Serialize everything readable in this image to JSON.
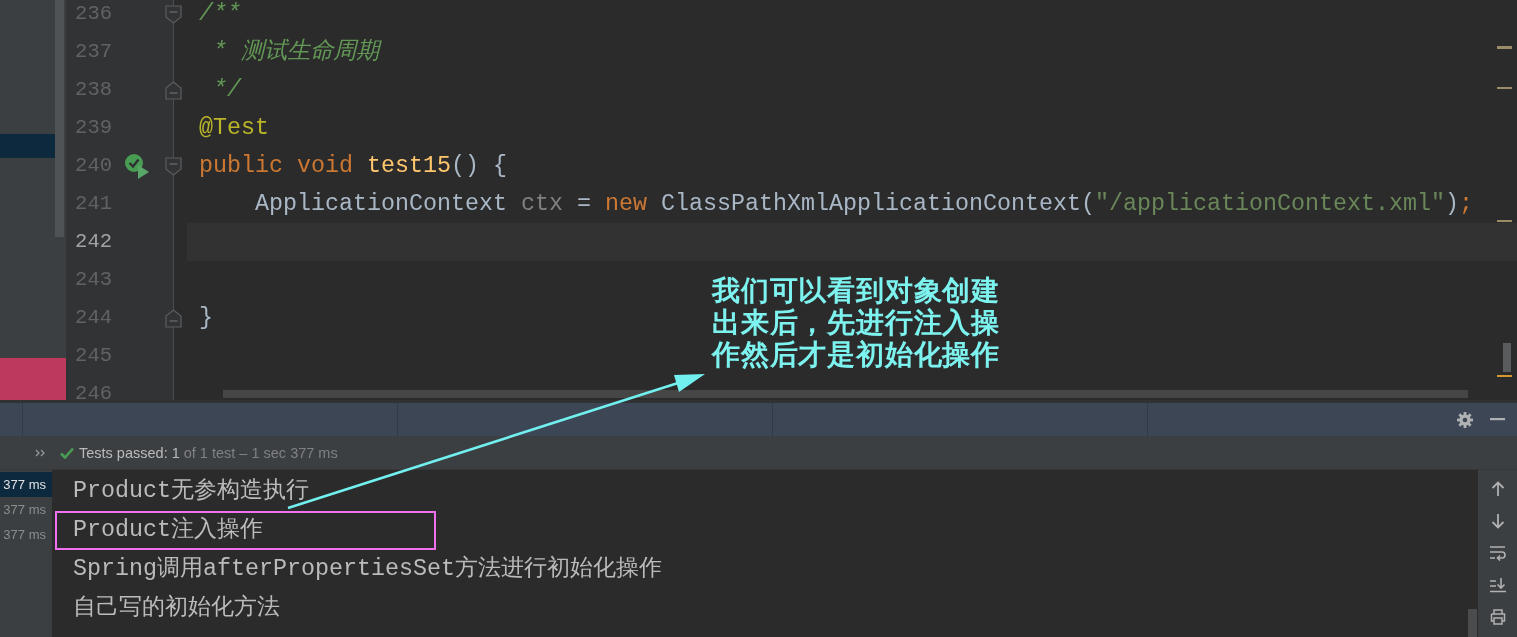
{
  "editor": {
    "lines": [
      {
        "number": "236",
        "current": false,
        "run_marker": false,
        "fold_start": true,
        "fold_end": false,
        "tokens": [
          {
            "kind": "comment",
            "text": "/**"
          }
        ]
      },
      {
        "number": "237",
        "current": false,
        "run_marker": false,
        "fold_start": false,
        "fold_end": false,
        "tokens": [
          {
            "kind": "comment",
            "text": " * 测试生命周期"
          }
        ]
      },
      {
        "number": "238",
        "current": false,
        "run_marker": false,
        "fold_start": false,
        "fold_end": true,
        "tokens": [
          {
            "kind": "comment",
            "text": " */"
          }
        ]
      },
      {
        "number": "239",
        "current": false,
        "run_marker": false,
        "fold_start": false,
        "fold_end": false,
        "tokens": [
          {
            "kind": "annotation",
            "text": "@Test"
          }
        ]
      },
      {
        "number": "240",
        "current": false,
        "run_marker": true,
        "fold_start": true,
        "fold_end": false,
        "tokens": [
          {
            "kind": "keyword",
            "text": "public void "
          },
          {
            "kind": "method",
            "text": "test15"
          },
          {
            "kind": "plain",
            "text": "() {"
          }
        ]
      },
      {
        "number": "241",
        "current": false,
        "run_marker": false,
        "fold_start": false,
        "fold_end": false,
        "tokens": [
          {
            "kind": "plain",
            "text": "    ApplicationContext "
          },
          {
            "kind": "unused",
            "text": "ctx"
          },
          {
            "kind": "plain",
            "text": " = "
          },
          {
            "kind": "keyword",
            "text": "new"
          },
          {
            "kind": "plain",
            "text": " ClassPathXmlApplicationContext("
          },
          {
            "kind": "string",
            "text": "\"/applicationContext.xml\""
          },
          {
            "kind": "plain",
            "text": ")"
          },
          {
            "kind": "keyword",
            "text": ";"
          }
        ]
      },
      {
        "number": "242",
        "current": true,
        "run_marker": false,
        "fold_start": false,
        "fold_end": false
      },
      {
        "number": "243",
        "current": false,
        "run_marker": false,
        "fold_start": false,
        "fold_end": false
      },
      {
        "number": "244",
        "current": false,
        "run_marker": false,
        "fold_start": false,
        "fold_end": true,
        "tokens": [
          {
            "kind": "plain",
            "text": "}"
          }
        ]
      },
      {
        "number": "245",
        "current": false,
        "run_marker": false,
        "fold_start": false,
        "fold_end": false
      },
      {
        "number": "246",
        "current": false,
        "run_marker": false,
        "fold_start": false,
        "fold_end": false
      }
    ]
  },
  "annotation": {
    "text": "我们可以看到对象创建出来后，先进行注入操作然后才是初始化操作"
  },
  "run_panel": {
    "status": {
      "passed": "Tests passed: 1",
      "detail": "of 1 test – 1 sec 377 ms"
    },
    "test_tree": [
      {
        "duration": "377 ms",
        "selected": true
      },
      {
        "duration": "377 ms",
        "selected": false
      },
      {
        "duration": "377 ms",
        "selected": false
      }
    ],
    "console_lines": [
      {
        "text": "Product无参构造执行",
        "highlighted": false
      },
      {
        "text": "Product注入操作",
        "highlighted": true
      },
      {
        "text": "Spring调用afterPropertiesSet方法进行初始化操作",
        "highlighted": false
      },
      {
        "text": "自己写的初始化方法",
        "highlighted": false
      }
    ]
  }
}
